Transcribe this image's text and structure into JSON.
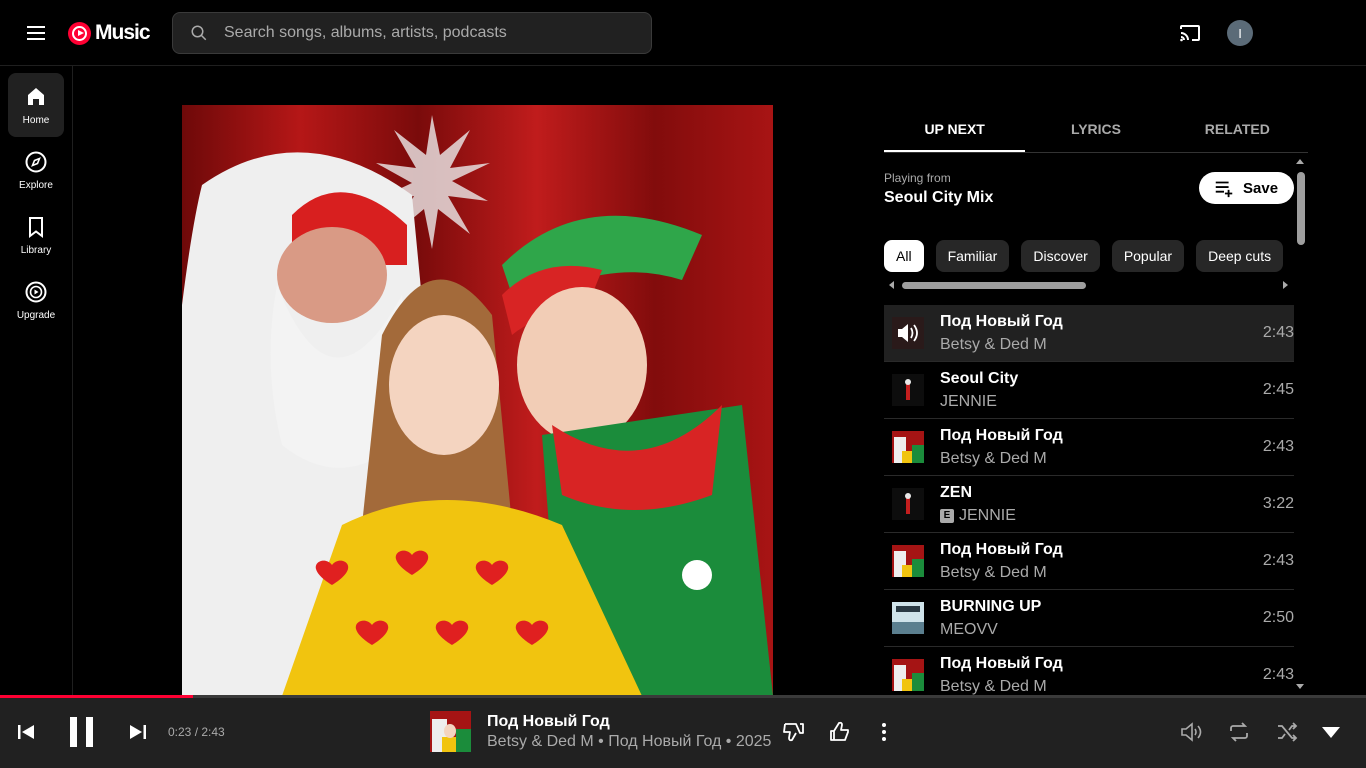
{
  "header": {
    "logo_text": "Music",
    "search_placeholder": "Search songs, albums, artists, podcasts",
    "avatar_initial": "I"
  },
  "sidebar": {
    "items": [
      {
        "label": "Home",
        "icon": "home-icon",
        "active": true
      },
      {
        "label": "Explore",
        "icon": "compass-icon",
        "active": false
      },
      {
        "label": "Library",
        "icon": "bookmark-icon",
        "active": false
      },
      {
        "label": "Upgrade",
        "icon": "play-circle-icon",
        "active": false
      }
    ]
  },
  "panel": {
    "tabs": [
      {
        "label": "UP NEXT",
        "active": true
      },
      {
        "label": "LYRICS",
        "active": false
      },
      {
        "label": "RELATED",
        "active": false
      }
    ],
    "playing_from_label": "Playing from",
    "playlist_name": "Seoul City Mix",
    "save_label": "Save",
    "chips": [
      {
        "label": "All",
        "active": true
      },
      {
        "label": "Familiar",
        "active": false
      },
      {
        "label": "Discover",
        "active": false
      },
      {
        "label": "Popular",
        "active": false
      },
      {
        "label": "Deep cuts",
        "active": false
      }
    ],
    "queue": [
      {
        "title": "Под Новый Год",
        "artist": "Betsy & Ded M",
        "duration": "2:43",
        "playing": true,
        "explicit": false,
        "thumb": "christmas"
      },
      {
        "title": "Seoul City",
        "artist": "JENNIE",
        "duration": "2:45",
        "playing": false,
        "explicit": false,
        "thumb": "jennie"
      },
      {
        "title": "Под Новый Год",
        "artist": "Betsy & Ded M",
        "duration": "2:43",
        "playing": false,
        "explicit": false,
        "thumb": "christmas"
      },
      {
        "title": "ZEN",
        "artist": "JENNIE",
        "duration": "3:22",
        "playing": false,
        "explicit": true,
        "thumb": "jennie"
      },
      {
        "title": "Под Новый Год",
        "artist": "Betsy & Ded M",
        "duration": "2:43",
        "playing": false,
        "explicit": false,
        "thumb": "christmas"
      },
      {
        "title": "BURNING UP",
        "artist": "MEOVV",
        "duration": "2:50",
        "playing": false,
        "explicit": false,
        "thumb": "meovv"
      },
      {
        "title": "Под Новый Год",
        "artist": "Betsy & Ded M",
        "duration": "2:43",
        "playing": false,
        "explicit": false,
        "thumb": "christmas"
      }
    ]
  },
  "player": {
    "time": "0:23 / 2:43",
    "progress": 0.141,
    "title": "Под Новый Год",
    "subtitle": "Betsy & Ded M • Под Новый Год • 2025"
  },
  "colors": {
    "accent": "#ff0033",
    "background": "#000000",
    "surface": "#212121"
  }
}
